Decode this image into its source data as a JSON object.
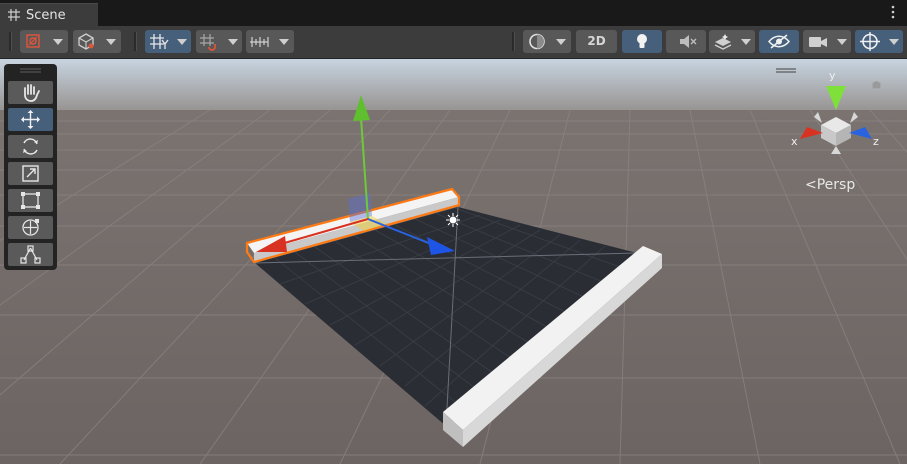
{
  "window": {
    "tab_title": "Scene"
  },
  "toolbar": {
    "btn_2d_label": "2D"
  },
  "icons": {
    "tab": "grid-hash-icon",
    "menu": "kebab-menu-icon",
    "draw_mode": "draw-mode-icon",
    "render_mode": "cube-render-icon",
    "grid": "grid-snap-icon",
    "snap": "increment-snap-icon",
    "ruler": "ruler-icon",
    "shading": "sphere-shading-icon",
    "lighting": "lightbulb-icon",
    "audio": "audio-mute-icon",
    "effects": "effects-layers-icon",
    "visibility": "eye-hidden-icon",
    "camera": "camera-icon",
    "gizmos": "gizmo-crosshair-icon"
  },
  "gizmo": {
    "projection_label": "Persp",
    "axis_x": "x",
    "axis_y": "y",
    "axis_z": "z"
  },
  "tools": [
    {
      "name": "hand-tool"
    },
    {
      "name": "move-tool",
      "selected": true
    },
    {
      "name": "rotate-tool"
    },
    {
      "name": "scale-tool"
    },
    {
      "name": "rect-tool"
    },
    {
      "name": "transform-tool"
    },
    {
      "name": "custom-editor-tool"
    }
  ],
  "colors": {
    "selection_outline": "#ff7a14",
    "axis_x": "#d83222",
    "axis_y": "#6ec93a",
    "axis_z": "#2a63e0",
    "active_button": "#46607c"
  }
}
